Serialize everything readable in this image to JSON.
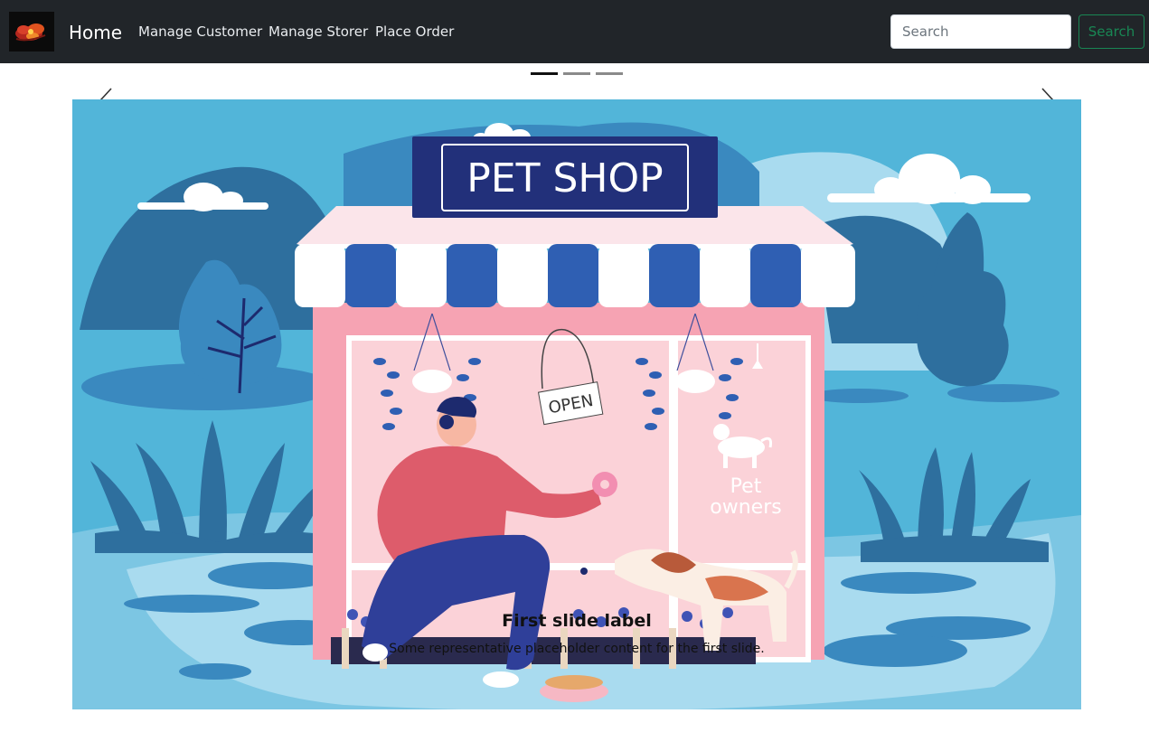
{
  "navbar": {
    "brand": "Home",
    "links": [
      "Manage Customer",
      "Manage Storer",
      "Place Order"
    ],
    "search": {
      "placeholder": "Search",
      "value": "",
      "button_label": "Search"
    },
    "logo_icon": "red-flower-logo"
  },
  "carousel": {
    "indicator_count": 3,
    "active_index": 0,
    "prev_icon": "chevron-left-icon",
    "next_icon": "chevron-right-icon",
    "slide": {
      "sign_text": "PET SHOP",
      "open_sign": "OPEN",
      "window_text_1": "Pet",
      "window_text_2": "owners",
      "caption_title": "First slide label",
      "caption_text": "Some representative placeholder content for the first slide."
    }
  },
  "colors": {
    "navbar_bg": "#212529",
    "search_button": "#198754",
    "sky": "#52b5d9",
    "shop_pink": "#f6a3b3",
    "awning_blue": "#2f5fb3",
    "sign_navy": "#22307a"
  }
}
